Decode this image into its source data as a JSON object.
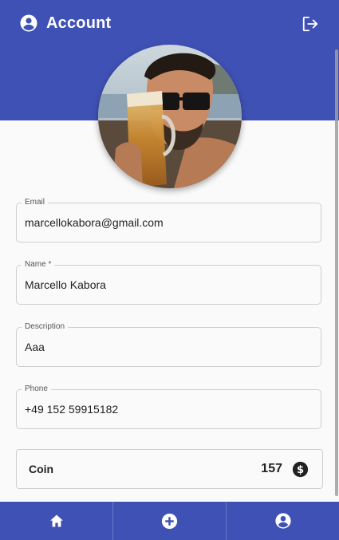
{
  "header": {
    "title": "Account",
    "account_icon": "account-circle-icon",
    "logout_icon": "logout-icon"
  },
  "profile": {
    "avatar": "profile-photo"
  },
  "fields": {
    "email": {
      "label": "Email",
      "value": "marcellokabora@gmail.com"
    },
    "name": {
      "label": "Name *",
      "value": "Marcello Kabora"
    },
    "description": {
      "label": "Description",
      "value": "Aaa"
    },
    "phone": {
      "label": "Phone",
      "value": "+49 152 59915182"
    }
  },
  "coin": {
    "label": "Coin",
    "value": "157",
    "icon": "dollar-circle-icon"
  },
  "bottom_nav": {
    "items": [
      {
        "icon": "home-icon"
      },
      {
        "icon": "add-circle-icon"
      },
      {
        "icon": "account-circle-icon"
      }
    ]
  },
  "colors": {
    "primary": "#3f51b5",
    "background": "#fafafa",
    "border": "#cfcfcf",
    "text": "#222222"
  }
}
